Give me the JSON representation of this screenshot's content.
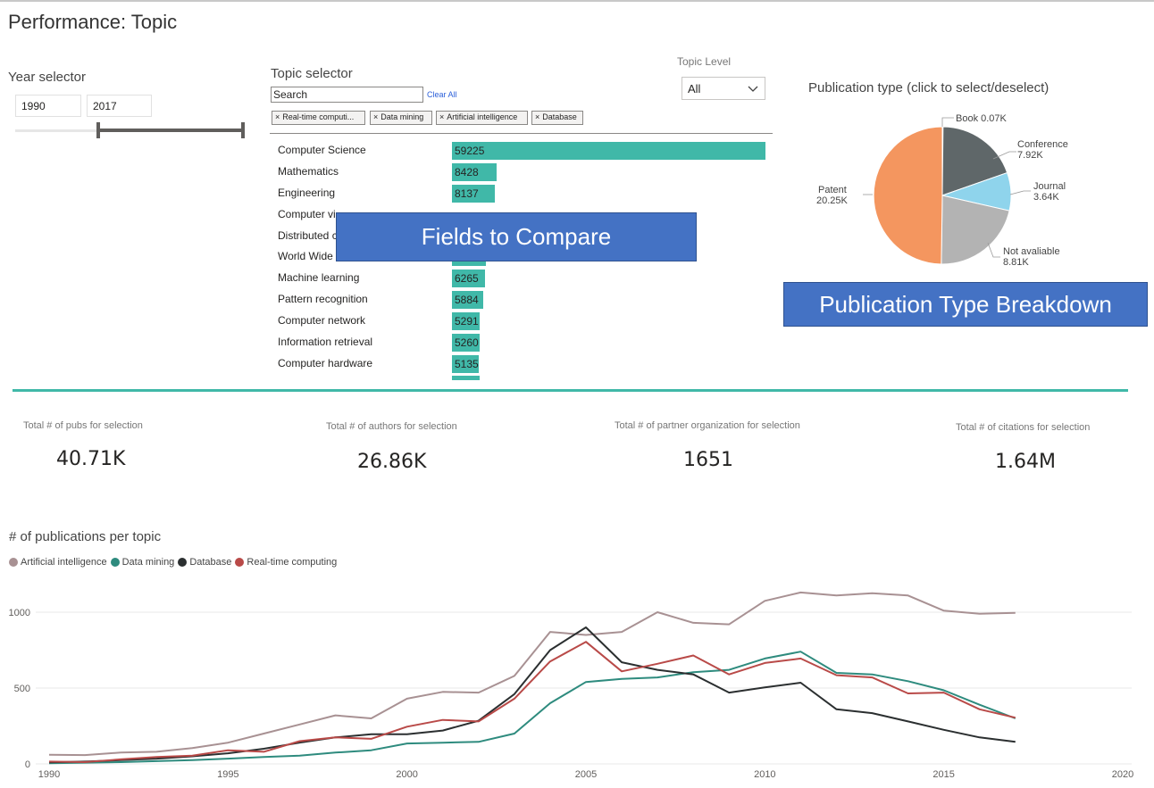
{
  "page": {
    "title": "Performance: Topic"
  },
  "year_selector": {
    "label": "Year selector",
    "from": "1990",
    "to": "2017"
  },
  "topic_selector": {
    "label": "Topic selector",
    "search_placeholder": "Search",
    "clear_all": "Clear All",
    "chips": [
      "Real-time computi...",
      "Data mining",
      "Artificial intelligence",
      "Database"
    ],
    "chip_close": "×",
    "bars": [
      {
        "label": "Computer Science",
        "value": 59225,
        "display": "59225"
      },
      {
        "label": "Mathematics",
        "value": 8428,
        "display": "8428"
      },
      {
        "label": "Engineering",
        "value": 8137,
        "display": "8137"
      },
      {
        "label": "Computer vi",
        "value": null,
        "display": ""
      },
      {
        "label": "Distributed c",
        "value": null,
        "display": ""
      },
      {
        "label": "World Wide",
        "value": null,
        "display": ""
      },
      {
        "label": "Machine learning",
        "value": 6265,
        "display": "6265"
      },
      {
        "label": "Pattern recognition",
        "value": 5884,
        "display": "5884"
      },
      {
        "label": "Computer network",
        "value": 5291,
        "display": "5291"
      },
      {
        "label": "Information retrieval",
        "value": 5260,
        "display": "5260"
      },
      {
        "label": "Computer hardware",
        "value": 5135,
        "display": "5135"
      }
    ],
    "bar_max": 59225
  },
  "topic_level": {
    "label": "Topic Level",
    "selected": "All"
  },
  "overlays": {
    "fields": "Fields to Compare",
    "pubtype": "Publication Type Breakdown"
  },
  "colors": {
    "teal": "#40b8a8",
    "overlay_blue": "#4472c4",
    "ai": "#a89193",
    "dm": "#2e8b7e",
    "db": "#2b2f30",
    "rt": "#b94a48",
    "book": "#5f6769",
    "conference": "#5f6769",
    "journal": "#8fd4ec",
    "notavail": "#b3b3b3",
    "patent": "#f4965f"
  },
  "pie": {
    "title": "Publication type (click to select/deselect)",
    "slices": [
      {
        "name": "Book",
        "value": 0.07,
        "label": "Book 0.07K",
        "color": "#5f6769"
      },
      {
        "name": "Conference",
        "value": 7.92,
        "label": "Conference",
        "value_label": "7.92K",
        "color": "#5f6769"
      },
      {
        "name": "Journal",
        "value": 3.64,
        "label": "Journal",
        "value_label": "3.64K",
        "color": "#8fd4ec"
      },
      {
        "name": "Not avaliable",
        "value": 8.81,
        "label": "Not avaliable",
        "value_label": "8.81K",
        "color": "#b3b3b3"
      },
      {
        "name": "Patent",
        "value": 20.25,
        "label": "Patent",
        "value_label": "20.25K",
        "color": "#f4965f"
      }
    ]
  },
  "kpis": [
    {
      "label": "Total # of pubs for selection",
      "value": "40.71K"
    },
    {
      "label": "Total # of authors for selection",
      "value": "26.86K"
    },
    {
      "label": "Total # of partner organization for selection",
      "value": "1651"
    },
    {
      "label": "Total # of citations for selection",
      "value": "1.64M"
    }
  ],
  "chart_data": {
    "type": "line",
    "title": "# of publications per topic",
    "xlim": [
      1990,
      2020
    ],
    "ylim": [
      0,
      1000
    ],
    "xticks": [
      1990,
      1995,
      2000,
      2005,
      2010,
      2015,
      2020
    ],
    "yticks": [
      0,
      500,
      1000
    ],
    "grid": true,
    "legend_placement": "top-left",
    "x": [
      1990,
      1991,
      1992,
      1993,
      1994,
      1995,
      1996,
      1997,
      1998,
      1999,
      2000,
      2001,
      2002,
      2003,
      2004,
      2005,
      2006,
      2007,
      2008,
      2009,
      2010,
      2011,
      2012,
      2013,
      2014,
      2015,
      2016,
      2017
    ],
    "series": [
      {
        "name": "Artificial intelligence",
        "color": "#a89193",
        "values": [
          60,
          58,
          75,
          80,
          105,
          140,
          200,
          260,
          320,
          300,
          430,
          475,
          470,
          580,
          870,
          850,
          870,
          1000,
          930,
          920,
          1075,
          1130,
          1110,
          1125,
          1110,
          1010,
          990,
          995
        ]
      },
      {
        "name": "Data mining",
        "color": "#2e8b7e",
        "values": [
          5,
          8,
          12,
          18,
          25,
          35,
          45,
          55,
          75,
          90,
          135,
          140,
          145,
          200,
          400,
          540,
          560,
          570,
          605,
          620,
          695,
          740,
          600,
          590,
          545,
          485,
          390,
          300
        ]
      },
      {
        "name": "Database",
        "color": "#2b2f30",
        "values": [
          10,
          15,
          25,
          35,
          50,
          70,
          100,
          140,
          175,
          195,
          195,
          220,
          285,
          460,
          750,
          900,
          670,
          620,
          590,
          470,
          505,
          535,
          360,
          335,
          280,
          225,
          175,
          145
        ]
      },
      {
        "name": "Real-time computing",
        "color": "#b94a48",
        "values": [
          15,
          12,
          30,
          45,
          55,
          90,
          80,
          150,
          175,
          165,
          245,
          290,
          280,
          430,
          675,
          805,
          610,
          660,
          715,
          590,
          665,
          695,
          585,
          570,
          465,
          470,
          360,
          305
        ]
      }
    ]
  }
}
